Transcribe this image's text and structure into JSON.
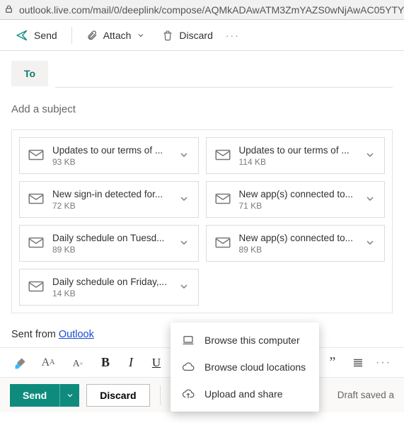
{
  "url": "outlook.live.com/mail/0/deeplink/compose/AQMkADAwATM3ZmYAZS0wNjAwAC05YTY",
  "toolbar": {
    "send": "Send",
    "attach": "Attach",
    "discard": "Discard"
  },
  "compose": {
    "to_label": "To",
    "subject_placeholder": "Add a subject"
  },
  "attachments": [
    {
      "title": "Updates to our terms of ...",
      "size": "93 KB"
    },
    {
      "title": "Updates to our terms of ...",
      "size": "114 KB"
    },
    {
      "title": "New sign-in detected for...",
      "size": "72 KB"
    },
    {
      "title": "New app(s) connected to...",
      "size": "71 KB"
    },
    {
      "title": "Daily schedule on Tuesd...",
      "size": "89 KB"
    },
    {
      "title": "New app(s) connected to...",
      "size": "89 KB"
    },
    {
      "title": "Daily schedule on Friday,...",
      "size": "14 KB"
    }
  ],
  "signature": {
    "prefix": "Sent from ",
    "link": "Outlook"
  },
  "format": {
    "bold": "B",
    "italic": "I",
    "underline": "U",
    "quote": "”",
    "dots": "···"
  },
  "attach_menu": {
    "browse_computer": "Browse this computer",
    "browse_cloud": "Browse cloud locations",
    "upload_share": "Upload and share"
  },
  "bottom": {
    "send": "Send",
    "discard": "Discard",
    "status": "Draft saved a"
  }
}
